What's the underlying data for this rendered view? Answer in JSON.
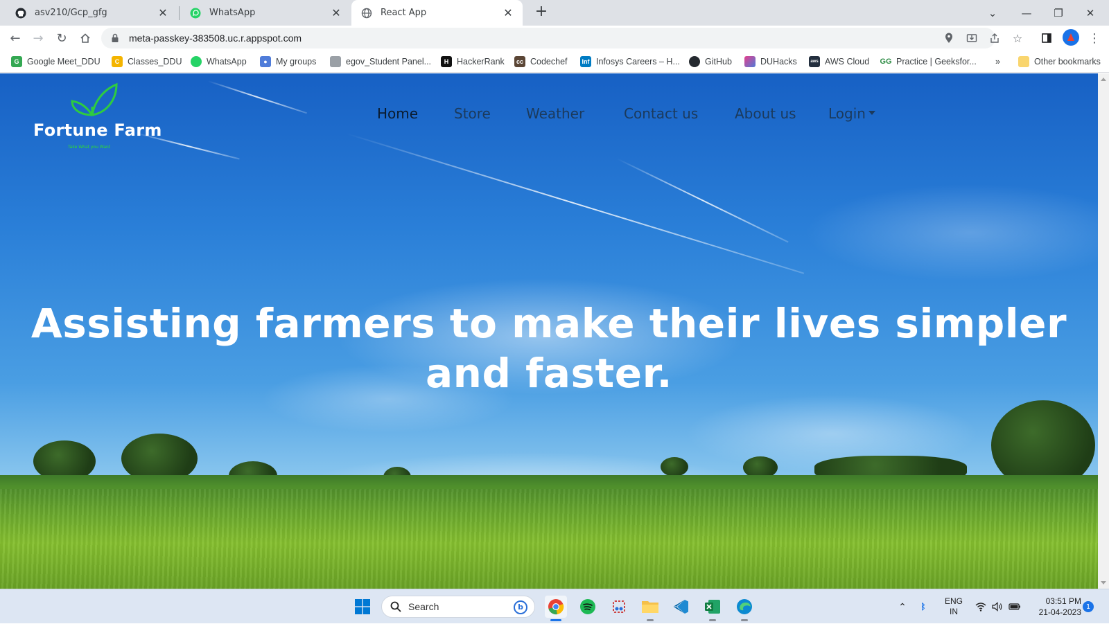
{
  "browser": {
    "tabs": [
      {
        "title": "asv210/Gcp_gfg",
        "icon": "github-icon"
      },
      {
        "title": "WhatsApp",
        "icon": "whatsapp-icon"
      },
      {
        "title": "React App",
        "icon": "globe-icon",
        "active": true
      }
    ],
    "address": "meta-passkey-383508.uc.r.appspot.com",
    "bookmarks": [
      {
        "label": "Google Meet_DDU",
        "icon": "google-classroom-icon"
      },
      {
        "label": "Classes_DDU",
        "icon": "classroom-icon"
      },
      {
        "label": "WhatsApp",
        "icon": "whatsapp-icon"
      },
      {
        "label": "My groups",
        "icon": "groups-icon"
      },
      {
        "label": "egov_Student Panel...",
        "icon": "egov-icon"
      },
      {
        "label": "HackerRank",
        "icon": "hackerrank-icon"
      },
      {
        "label": "Codechef",
        "icon": "codechef-icon"
      },
      {
        "label": "Infosys Careers – H...",
        "icon": "infosys-icon"
      },
      {
        "label": "GitHub",
        "icon": "github-icon"
      },
      {
        "label": "DUHacks",
        "icon": "duhacks-icon"
      },
      {
        "label": "AWS Cloud",
        "icon": "aws-icon"
      },
      {
        "label": "Practice | Geeksfor...",
        "icon": "geeksforgeeks-icon"
      }
    ],
    "overflow_label": "»",
    "other_bookmarks": "Other bookmarks"
  },
  "site": {
    "brand": "Fortune Farm",
    "tagline": "Take What you Want",
    "nav": [
      {
        "label": "Home",
        "active": true
      },
      {
        "label": "Store"
      },
      {
        "label": "Weather"
      },
      {
        "label": "Contact us"
      },
      {
        "label": "About us"
      },
      {
        "label": "Login",
        "dropdown": true
      }
    ],
    "hero_line1": "Assisting farmers to make their lives simpler",
    "hero_line2": "and faster."
  },
  "taskbar": {
    "search_placeholder": "Search",
    "apps": [
      "windows-start-icon",
      "chrome-icon",
      "spotify-icon",
      "snipping-tool-icon",
      "file-explorer-icon",
      "vscode-icon",
      "excel-icon",
      "edge-icon"
    ],
    "lang_line1": "ENG",
    "lang_line2": "IN",
    "time": "03:51 PM",
    "date": "21-04-2023",
    "notification_count": "1"
  },
  "colors": {
    "accent": "#1a73e8",
    "brand_leaf": "#2ecc40",
    "nav_text": "#1b3a5c"
  }
}
